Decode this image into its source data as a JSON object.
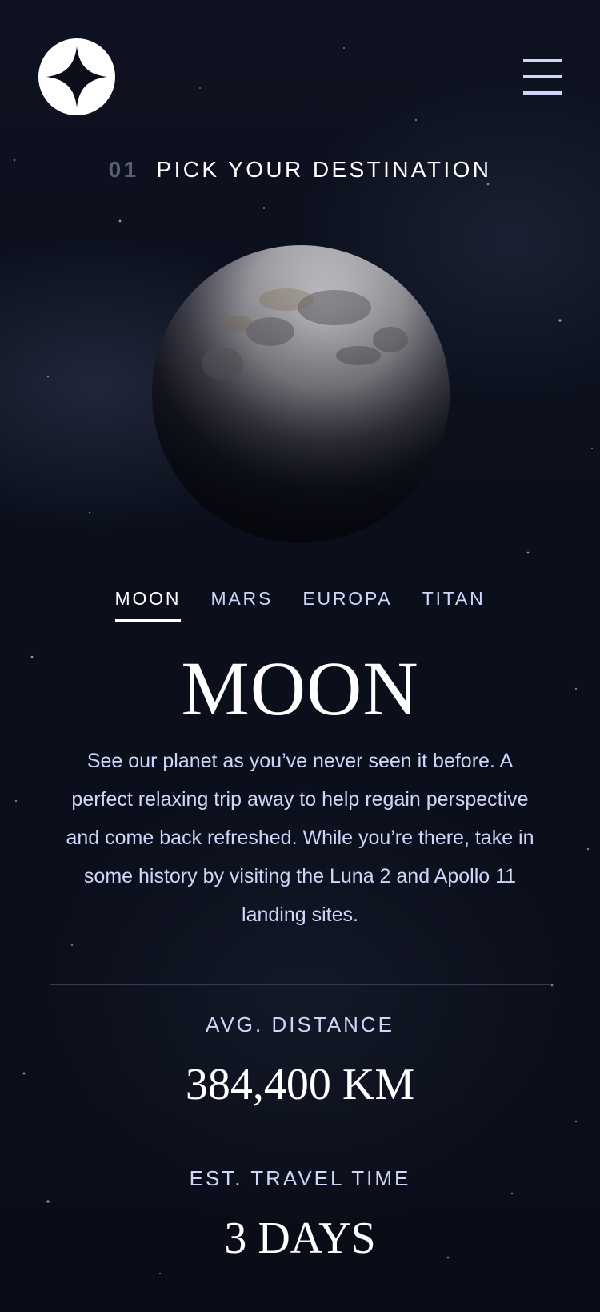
{
  "brand": {
    "logo_icon": "four-point-star-logo"
  },
  "nav": {
    "menu_icon": "hamburger-icon"
  },
  "page": {
    "heading_number": "01",
    "heading_text": "PICK YOUR DESTINATION"
  },
  "destination_tabs": [
    {
      "label": "MOON",
      "active": true
    },
    {
      "label": "MARS",
      "active": false
    },
    {
      "label": "EUROPA",
      "active": false
    },
    {
      "label": "TITAN",
      "active": false
    }
  ],
  "destination": {
    "name": "MOON",
    "description": "See our planet as you’ve never seen it before. A perfect relaxing trip away to help regain perspective and come back refreshed. While you’re there, take in some history by visiting the Luna 2 and Apollo 11 landing sites.",
    "image": "moon-image",
    "stats": {
      "distance_label": "AVG. DISTANCE",
      "distance_value": "384,400 KM",
      "travel_label": "EST. TRAVEL TIME",
      "travel_value": "3 DAYS"
    }
  },
  "colors": {
    "background": "#0b0d17",
    "accent_light": "#d0d6f9",
    "white": "#ffffff",
    "muted_number": "#5b6070"
  }
}
